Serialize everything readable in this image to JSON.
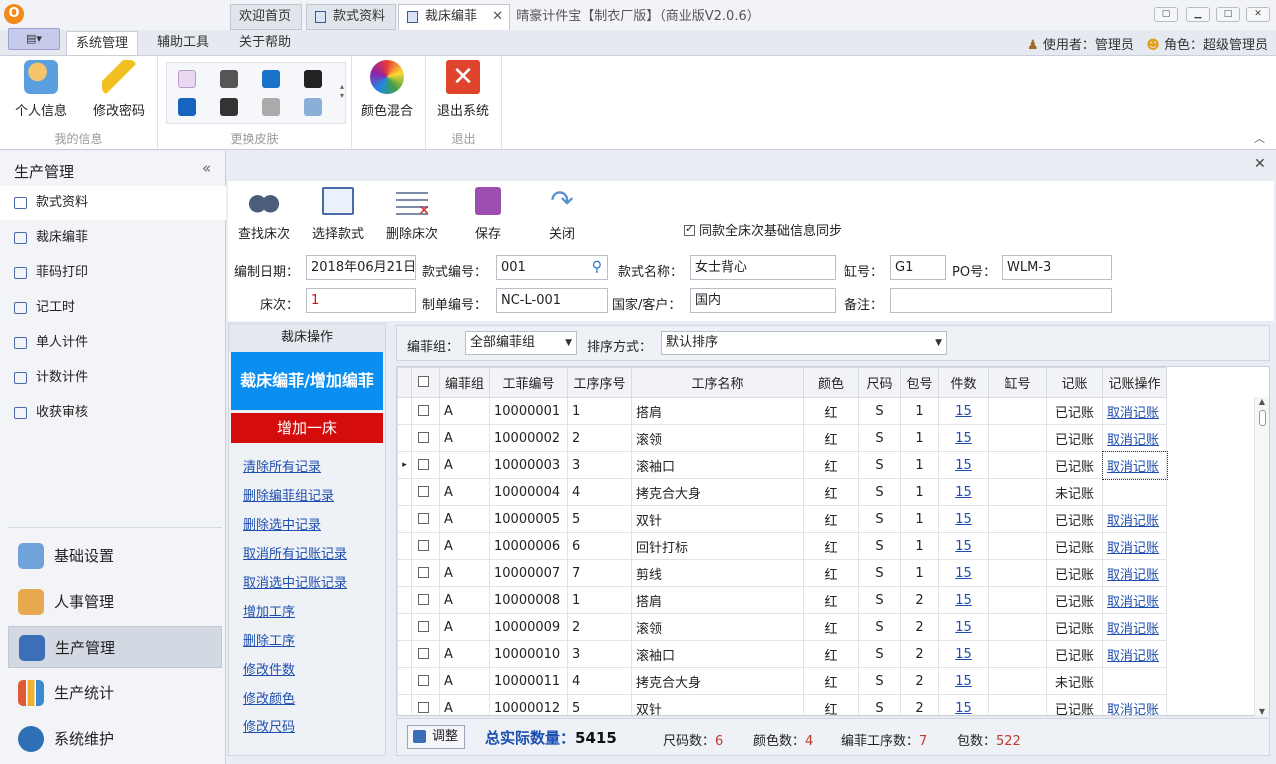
{
  "window": {
    "title": "晴豪计件宝【制衣厂版】（商业版V2.0.6）",
    "logo_letter": "O"
  },
  "ribbon": {
    "tabs": [
      {
        "label": "系统管理"
      },
      {
        "label": "辅助工具"
      },
      {
        "label": "关于帮助"
      }
    ],
    "user": {
      "prefix": "使用者：",
      "name": "管理员",
      "role_prefix": "角色：",
      "role": "超级管理员"
    },
    "groups": {
      "my_info": {
        "label": "我的信息",
        "personal": "个人信息",
        "password": "修改密码"
      },
      "skin": {
        "label": "更换皮肤"
      },
      "color": {
        "label": "颜色混合"
      },
      "exit": {
        "label": "退出",
        "button": "退出系统"
      }
    }
  },
  "sidebar": {
    "title": "生产管理",
    "collapse": "«",
    "items": [
      {
        "label": "款式资料"
      },
      {
        "label": "裁床编菲"
      },
      {
        "label": "菲码打印"
      },
      {
        "label": "记工时"
      },
      {
        "label": "单人计件"
      },
      {
        "label": "计数计件"
      },
      {
        "label": "收获审核"
      }
    ],
    "modules": [
      {
        "label": "基础设置"
      },
      {
        "label": "人事管理"
      },
      {
        "label": "生产管理"
      },
      {
        "label": "生产统计"
      },
      {
        "label": "系统维护"
      }
    ]
  },
  "doc_tabs": [
    {
      "label": "欢迎首页"
    },
    {
      "label": "款式资料"
    },
    {
      "label": "裁床编菲"
    }
  ],
  "toolbar": {
    "find": "查找床次",
    "select": "选择款式",
    "delete": "删除床次",
    "save": "保存",
    "close": "关闭",
    "sync": "同款全床次基础信息同步"
  },
  "form": {
    "date_label": "编制日期：",
    "date": "2018年06月21日",
    "style_no_label": "款式编号：",
    "style_no": "001",
    "style_name_label": "款式名称：",
    "style_name": "女士背心",
    "vat_label": "缸号：",
    "vat": "G1",
    "po_label": "PO号：",
    "po": "WLM-3",
    "bed_label": "床次：",
    "bed": "1",
    "order_label": "制单编号：",
    "order": "NC-L-001",
    "country_label": "国家/客户：",
    "country": "国内",
    "note_label": "备注：",
    "note": ""
  },
  "ops": {
    "title": "裁床操作",
    "add_bianfei": "裁床编菲/增加编菲",
    "add_bed": "增加一床",
    "links": [
      "清除所有记录",
      "删除编菲组记录",
      "删除选中记录",
      "取消所有记账记录",
      "取消选中记账记录",
      "增加工序",
      "删除工序",
      "修改件数",
      "修改颜色",
      "修改尺码"
    ]
  },
  "filter": {
    "group_label": "编菲组：",
    "group_value": "全部编菲组",
    "sort_label": "排序方式：",
    "sort_value": "默认排序"
  },
  "grid": {
    "columns": [
      "编菲组",
      "工菲编号",
      "工序序号",
      "工序名称",
      "颜色",
      "尺码",
      "包号",
      "件数",
      "缸号",
      "记账",
      "记账操作"
    ],
    "rows": [
      [
        "A",
        "10000001",
        "1",
        "搭肩",
        "红",
        "S",
        "1",
        "15",
        "",
        "已记账",
        "取消记账"
      ],
      [
        "A",
        "10000002",
        "2",
        "滚领",
        "红",
        "S",
        "1",
        "15",
        "",
        "已记账",
        "取消记账"
      ],
      [
        "A",
        "10000003",
        "3",
        "滚袖口",
        "红",
        "S",
        "1",
        "15",
        "",
        "已记账",
        "取消记账"
      ],
      [
        "A",
        "10000004",
        "4",
        "拷克合大身",
        "红",
        "S",
        "1",
        "15",
        "",
        "未记账",
        ""
      ],
      [
        "A",
        "10000005",
        "5",
        "双针",
        "红",
        "S",
        "1",
        "15",
        "",
        "已记账",
        "取消记账"
      ],
      [
        "A",
        "10000006",
        "6",
        "回针打标",
        "红",
        "S",
        "1",
        "15",
        "",
        "已记账",
        "取消记账"
      ],
      [
        "A",
        "10000007",
        "7",
        "剪线",
        "红",
        "S",
        "1",
        "15",
        "",
        "已记账",
        "取消记账"
      ],
      [
        "A",
        "10000008",
        "1",
        "搭肩",
        "红",
        "S",
        "2",
        "15",
        "",
        "已记账",
        "取消记账"
      ],
      [
        "A",
        "10000009",
        "2",
        "滚领",
        "红",
        "S",
        "2",
        "15",
        "",
        "已记账",
        "取消记账"
      ],
      [
        "A",
        "10000010",
        "3",
        "滚袖口",
        "红",
        "S",
        "2",
        "15",
        "",
        "已记账",
        "取消记账"
      ],
      [
        "A",
        "10000011",
        "4",
        "拷克合大身",
        "红",
        "S",
        "2",
        "15",
        "",
        "未记账",
        ""
      ],
      [
        "A",
        "10000012",
        "5",
        "双针",
        "红",
        "S",
        "2",
        "15",
        "",
        "已记账",
        "取消记账"
      ]
    ]
  },
  "status": {
    "adjust": "调整",
    "total_label": "总实际数量：",
    "total": "5415",
    "size_label": "尺码数：",
    "size": "6",
    "color_label": "颜色数：",
    "color": "4",
    "proc_label": "编菲工序数：",
    "proc": "7",
    "pack_label": "包数：",
    "pack": "522"
  },
  "colors": {
    "accent_blue": "#0a8ff0",
    "accent_red": "#d40c0c",
    "link": "#1f4fae",
    "value_red": "#c0392b"
  }
}
